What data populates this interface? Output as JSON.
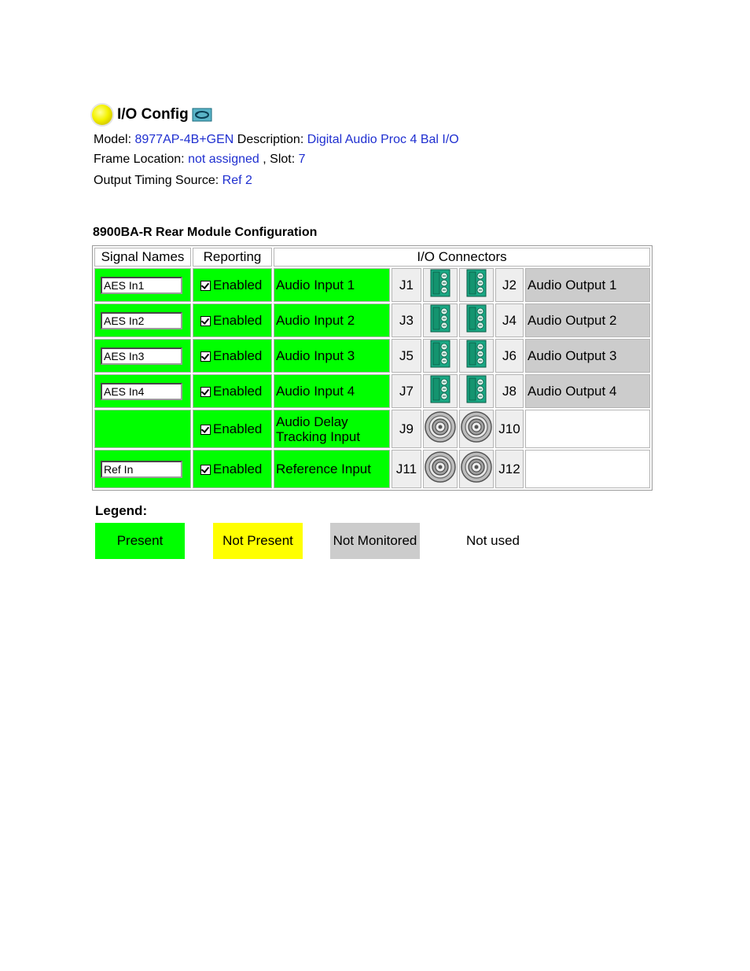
{
  "header": {
    "title": "I/O Config",
    "status_icon": "status-light-icon",
    "refresh_icon": "refresh-icon"
  },
  "info": {
    "model_label": "Model:",
    "model_value": "8977AP-4B+GEN",
    "description_label": "Description:",
    "description_value": "Digital Audio Proc 4 Bal I/O",
    "frame_location_label": "Frame Location:",
    "frame_location_value": "not assigned",
    "slot_label": ", Slot:",
    "slot_value": "7",
    "timing_label": "Output Timing Source:",
    "timing_value": "Ref 2"
  },
  "module": {
    "title": "8900BA-R Rear Module Configuration",
    "headers": [
      "Signal Names",
      "Reporting",
      "I/O Connectors"
    ],
    "rows": [
      {
        "name": "AES In1",
        "reporting": "Enabled",
        "signal": "Audio Input 1",
        "jin": "J1",
        "jout": "J2",
        "output": "Audio Output 1"
      },
      {
        "name": "AES In2",
        "reporting": "Enabled",
        "signal": "Audio Input 2",
        "jin": "J3",
        "jout": "J4",
        "output": "Audio Output 2"
      },
      {
        "name": "AES In3",
        "reporting": "Enabled",
        "signal": "Audio Input 3",
        "jin": "J5",
        "jout": "J6",
        "output": "Audio Output 3"
      },
      {
        "name": "AES In4",
        "reporting": "Enabled",
        "signal": "Audio Input 4",
        "jin": "J7",
        "jout": "J8",
        "output": "Audio Output 4"
      },
      {
        "name": "",
        "reporting": "Enabled",
        "signal_line1": "Audio Delay",
        "signal_line2": "Tracking Input",
        "jin": "J9",
        "jout": "J10",
        "output": ""
      },
      {
        "name": "Ref In",
        "reporting": "Enabled",
        "signal": "Reference Input",
        "jin": "J11",
        "jout": "J12",
        "output": ""
      }
    ]
  },
  "legend": {
    "title": "Legend:",
    "items": [
      "Present",
      "Not Present",
      "Not Monitored",
      "Not used"
    ],
    "colors": {
      "present": "#00ff00",
      "not_present": "#ffff00",
      "not_monitored": "#cccccc",
      "not_used": "#ffffff"
    }
  }
}
